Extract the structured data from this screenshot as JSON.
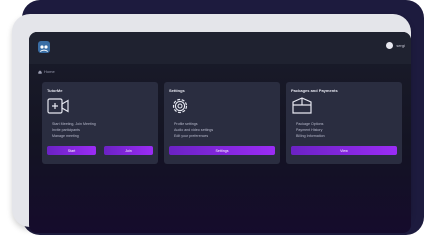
{
  "header": {
    "username": "sergi"
  },
  "breadcrumb": {
    "label": "Home"
  },
  "cards": [
    {
      "title": "TutorMe",
      "items": [
        "Start Meeting, Join Meeting",
        "Invite participants",
        "Manage meeting"
      ],
      "buttons": [
        "Start",
        "Join"
      ]
    },
    {
      "title": "Settings",
      "items": [
        "Profile settings",
        "Audio and video settings",
        "Edit your preferences"
      ],
      "buttons": [
        "Settings"
      ]
    },
    {
      "title": "Packages and Payments",
      "items": [
        "Package Options",
        "Payment History",
        "Billing Information"
      ],
      "buttons": [
        "View"
      ]
    }
  ],
  "colors": {
    "accent": "#8b2bf0",
    "screen_bg": "#151624",
    "card_bg": "#2a2d40"
  }
}
